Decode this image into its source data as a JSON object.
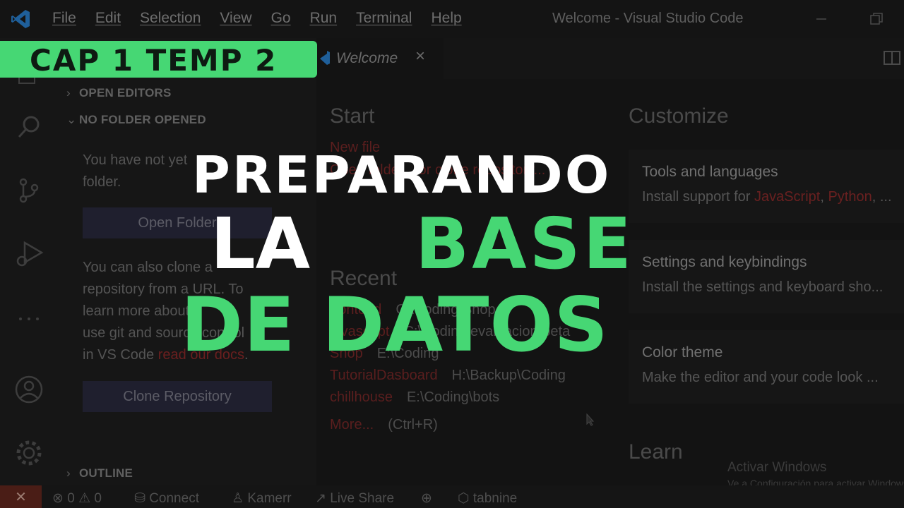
{
  "titlebar": {
    "menu": [
      "File",
      "Edit",
      "Selection",
      "View",
      "Go",
      "Run",
      "Terminal",
      "Help"
    ],
    "window_title": "Welcome - Visual Studio Code"
  },
  "sidebar": {
    "open_editors": "OPEN EDITORS",
    "no_folder": "NO FOLDER OPENED",
    "no_folder_msg_1": "You have not yet",
    "no_folder_msg_2": "folder.",
    "open_folder_btn": "Open Folder",
    "clone_msg_1": "You can also clone a",
    "clone_msg_2": "repository from a URL. To",
    "clone_msg_3": "learn more about",
    "clone_msg_4": "use git and source control",
    "clone_msg_5_pre": "in VS Code",
    "clone_msg_5_link": "read our docs",
    "clone_msg_5_post": ".",
    "clone_btn": "Clone Repository",
    "outline": "OUTLINE"
  },
  "tabs": {
    "welcome": "Welcome"
  },
  "welcome": {
    "start_heading": "Start",
    "new_file": "New file",
    "open_folder_link": "Open folder... or clone repository...",
    "recent_heading": "Recent",
    "recent": [
      {
        "name": "frontend",
        "path": "C:\\Coding\\Shop"
      },
      {
        "name": "javascript",
        "path": "C:\\Coding\\evaluacion-peta"
      },
      {
        "name": "Shop",
        "path": "E:\\Coding"
      },
      {
        "name": "TutorialDasboard",
        "path": "H:\\Backup\\Coding"
      },
      {
        "name": "chillhouse",
        "path": "E:\\Coding\\bots"
      }
    ],
    "more_link": "More...",
    "more_shortcut": "(Ctrl+R)",
    "customize_heading": "Customize",
    "cards": [
      {
        "title": "Tools and languages",
        "desc_pre": "Install support for ",
        "desc_js": "JavaScript",
        "desc_sep": ", ",
        "desc_py": "Python",
        "desc_post": ", ..."
      },
      {
        "title": "Settings and keybindings",
        "desc": "Install the settings and keyboard sho..."
      },
      {
        "title": "Color theme",
        "desc": "Make the editor and your code look ..."
      }
    ],
    "learn_heading": "Learn",
    "watermark_title": "Activar Windows",
    "watermark_sub": "Ve a Configuración para activar Windows."
  },
  "statusbar": {
    "errors": "0",
    "warnings": "0",
    "connect": "Connect",
    "user": "Kamerr",
    "live_share": "Live Share",
    "tabnine": "tabnine"
  },
  "overlay": {
    "banner": "CAP 1 TEMP 2",
    "line1": "PREPARANDO",
    "line2a": "LA",
    "line2b": "BASE",
    "line3": "DE DATOS",
    "accent": "#46d774"
  }
}
